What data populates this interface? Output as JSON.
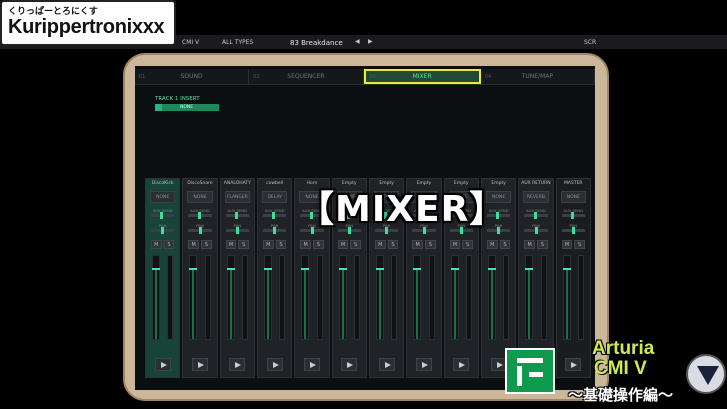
{
  "overlay": {
    "subtitle": "くりっぱーとろにくす",
    "channel_name": "Kurippertronixxx",
    "title_caption": "【MIXER】"
  },
  "topbar": {
    "product": "CMI V",
    "types_filter": "ALL TYPES",
    "preset_name": "83 Breakdance",
    "prev_label": "◀",
    "next_label": "▶",
    "scr_label": "SCR"
  },
  "tabs": [
    {
      "num": "01",
      "label": "SOUND"
    },
    {
      "num": "02",
      "label": "SEQUENCER"
    },
    {
      "num": "03",
      "label": "MIXER"
    },
    {
      "num": "04",
      "label": "TUNE/MAP"
    }
  ],
  "track_insert": {
    "label": "TRACK 1 INSERT",
    "slot": "NONE"
  },
  "channels": [
    {
      "name": "DiscoKick",
      "fx": "NONE"
    },
    {
      "name": "DiscoSnare",
      "fx": "NONE"
    },
    {
      "name": "ANALOHATY",
      "fx": "FLANGER"
    },
    {
      "name": "cowbell",
      "fx": "DELAY"
    },
    {
      "name": "Horn",
      "fx": "NONE"
    },
    {
      "name": "Empty",
      "fx": "NONE"
    },
    {
      "name": "Empty",
      "fx": "NONE"
    },
    {
      "name": "Empty",
      "fx": "NONE"
    },
    {
      "name": "Empty",
      "fx": "NONE"
    },
    {
      "name": "Empty",
      "fx": "NONE"
    },
    {
      "name": "AUX RETURN",
      "fx": "REVERB"
    },
    {
      "name": "MASTER",
      "fx": "NONE"
    }
  ],
  "labels": {
    "aux_send": "AUX SEND",
    "pan": "PAN",
    "mute": "M",
    "solo": "S"
  },
  "brand": {
    "line1": "Arturia",
    "line2": "CMI V",
    "line3": "〜基礎操作編〜"
  },
  "colors": {
    "accent": "#3ce099",
    "tab_highlight": "#ede83a",
    "bezel": "#cdb79a"
  }
}
